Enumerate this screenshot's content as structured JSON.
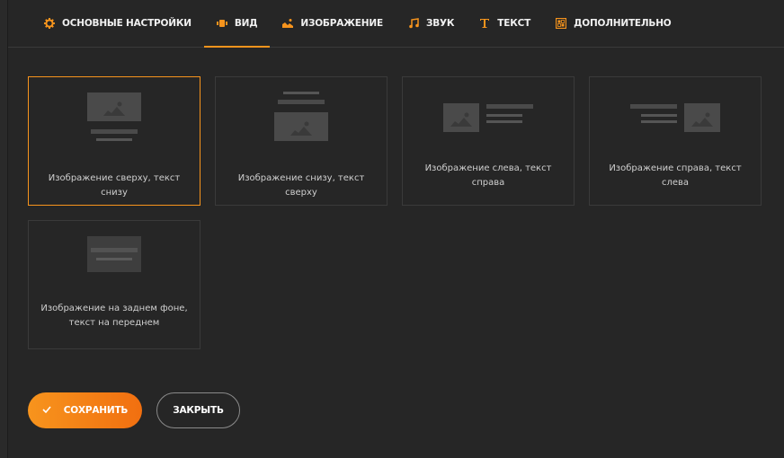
{
  "tabs": [
    {
      "label": "Основные настройки",
      "icon": "gear-icon",
      "active": false
    },
    {
      "label": "Вид",
      "icon": "layout-icon",
      "active": true
    },
    {
      "label": "Изображение",
      "icon": "image-icon",
      "active": false
    },
    {
      "label": "Звук",
      "icon": "music-note-icon",
      "active": false
    },
    {
      "label": "Текст",
      "icon": "text-icon",
      "active": false
    },
    {
      "label": "Дополнительно",
      "icon": "grid-icon",
      "active": false
    }
  ],
  "layouts": [
    {
      "label": "Изображение сверху, текст снизу",
      "selected": true
    },
    {
      "label": "Изображение снизу, текст сверху",
      "selected": false
    },
    {
      "label": "Изображение слева, текст справа",
      "selected": false
    },
    {
      "label": "Изображение справа, текст слева",
      "selected": false
    },
    {
      "label": "Изображение на заднем фоне, текст на переднем",
      "selected": false
    }
  ],
  "actions": {
    "save_label": "СОХРАНИТЬ",
    "close_label": "ЗАКРЫТЬ"
  },
  "colors": {
    "accent": "#f7941d",
    "background": "#262626",
    "border": "#3a3a3a"
  }
}
